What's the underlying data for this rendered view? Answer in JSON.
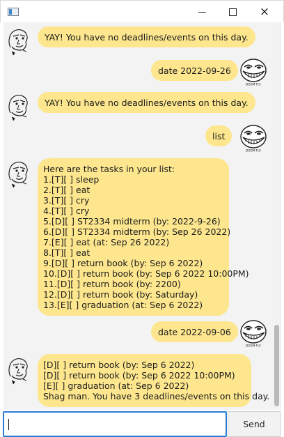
{
  "window": {
    "controls": {
      "minimize": "minimize-icon",
      "maximize": "maximize-icon",
      "close": "×"
    }
  },
  "messages": [
    {
      "sender": "duke",
      "lines": [
        "YAY! You have no deadlines/events on this day."
      ]
    },
    {
      "sender": "user",
      "lines": [
        "date 2022-09-26"
      ]
    },
    {
      "sender": "duke",
      "lines": [
        "YAY! You have no deadlines/events on this day."
      ]
    },
    {
      "sender": "user",
      "lines": [
        "list"
      ]
    },
    {
      "sender": "duke",
      "lines": [
        "Here are the tasks in your list:",
        "1.[T][ ] sleep",
        "2.[T][ ] eat",
        "3.[T][ ] cry",
        "4.[T][ ] cry",
        "5.[D][ ] ST2334 midterm (by: 2022-9-26)",
        "6.[D][ ] ST2334 midterm (by: Sep 26 2022)",
        "7.[E][ ] eat (at: Sep 26 2022)",
        "8.[T][ ] eat",
        "9.[D][ ] return book (by: Sep 6 2022)",
        "10.[D][ ] return book (by: Sep 6 2022 10:00PM)",
        "11.[D][ ] return book (by: 2200)",
        "12.[D][ ] return book (by: Saturday)",
        "13.[E][ ] graduation (at: Sep 6 2022)"
      ]
    },
    {
      "sender": "user",
      "lines": [
        "date 2022-09-06"
      ]
    },
    {
      "sender": "duke",
      "lines": [
        "[D][ ] return book (by: Sep 6 2022)",
        "[D][ ] return book (by: Sep 6 2022 10:00PM)",
        "[E][ ] graduation (at: Sep 6 2022)",
        "Shag man. You have 3 deadlines/events on this day."
      ]
    }
  ],
  "avatars": {
    "user_caption": "DOOM FU!"
  },
  "input": {
    "value": "",
    "placeholder": ""
  },
  "send_button": {
    "label": "Send"
  },
  "colors": {
    "bubble": "#fde68e",
    "chat_background": "#f3f3f3",
    "input_focus": "#2a7dd4"
  }
}
